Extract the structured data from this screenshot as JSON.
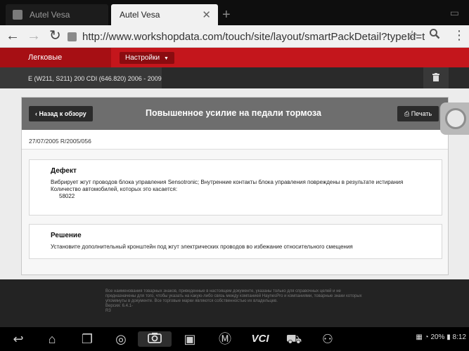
{
  "browser": {
    "tabs": [
      {
        "label": "Autel Vesa",
        "active": false
      },
      {
        "label": "Autel Vesa",
        "active": true
      }
    ],
    "url": "http://www.workshopdata.com/touch/site/layout/smartPackDetail?typeId=t_17780"
  },
  "app": {
    "brand": "Легковые",
    "settings_label": "Настройки",
    "vehicle": "E (W211, S211) 200 CDI (646.820) 2006 - 2009"
  },
  "page": {
    "back_label": "Назад к обзору",
    "title": "Повышенное усилие на педали тормоза",
    "print_label": "Печать",
    "date_ref": "27/07/2005 R/2005/056",
    "defect": {
      "heading": "Дефект",
      "text": "Вибрирует жгут проводов блока управления Sensotronic; Внутренние контакты блока управления повреждены в результате истирания",
      "count_label": "Количество автомобилей, которых это касается:",
      "count_value": "58022"
    },
    "solution": {
      "heading": "Решение",
      "text": "Установите дополнительный кронштейн под жгут электрических проводов во избежание относительного смещения"
    }
  },
  "footer": {
    "text1": "Все наименования товарных знаков, приведенные в настоящем документе, указаны только для справочных целей и не предназначены для того, чтобы указать на какую-либо связь между компанией HaynesPro и компаниями, товарные знаки которых упомянуты в документе. Все торговые марки являются собственностью их владельцев.",
    "version": "Версия: 6.4.1-",
    "code": "R3"
  },
  "system": {
    "battery": "20%",
    "time": "8:12",
    "vci": "VCI"
  }
}
